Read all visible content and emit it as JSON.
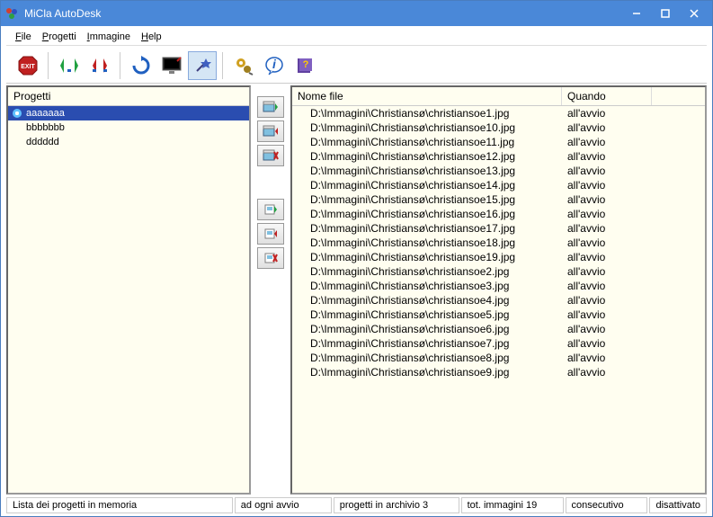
{
  "window": {
    "title": "MiCla AutoDesk"
  },
  "menu": {
    "file": "File",
    "progetti": "Progetti",
    "immagine": "Immagine",
    "help": "Help"
  },
  "panels": {
    "projects_header": "Progetti",
    "file_col": "Nome file",
    "when_col": "Quando"
  },
  "projects": [
    {
      "name": "aaaaaaa",
      "selected": true
    },
    {
      "name": "bbbbbbb",
      "selected": false
    },
    {
      "name": "dddddd",
      "selected": false
    }
  ],
  "files": [
    {
      "path": "D:\\Immagini\\Christiansø\\christiansoe1.jpg",
      "when": "all'avvio"
    },
    {
      "path": "D:\\Immagini\\Christiansø\\christiansoe10.jpg",
      "when": "all'avvio"
    },
    {
      "path": "D:\\Immagini\\Christiansø\\christiansoe11.jpg",
      "when": "all'avvio"
    },
    {
      "path": "D:\\Immagini\\Christiansø\\christiansoe12.jpg",
      "when": "all'avvio"
    },
    {
      "path": "D:\\Immagini\\Christiansø\\christiansoe13.jpg",
      "when": "all'avvio"
    },
    {
      "path": "D:\\Immagini\\Christiansø\\christiansoe14.jpg",
      "when": "all'avvio"
    },
    {
      "path": "D:\\Immagini\\Christiansø\\christiansoe15.jpg",
      "when": "all'avvio"
    },
    {
      "path": "D:\\Immagini\\Christiansø\\christiansoe16.jpg",
      "when": "all'avvio"
    },
    {
      "path": "D:\\Immagini\\Christiansø\\christiansoe17.jpg",
      "when": "all'avvio"
    },
    {
      "path": "D:\\Immagini\\Christiansø\\christiansoe18.jpg",
      "when": "all'avvio"
    },
    {
      "path": "D:\\Immagini\\Christiansø\\christiansoe19.jpg",
      "when": "all'avvio"
    },
    {
      "path": "D:\\Immagini\\Christiansø\\christiansoe2.jpg",
      "when": "all'avvio"
    },
    {
      "path": "D:\\Immagini\\Christiansø\\christiansoe3.jpg",
      "when": "all'avvio"
    },
    {
      "path": "D:\\Immagini\\Christiansø\\christiansoe4.jpg",
      "when": "all'avvio"
    },
    {
      "path": "D:\\Immagini\\Christiansø\\christiansoe5.jpg",
      "when": "all'avvio"
    },
    {
      "path": "D:\\Immagini\\Christiansø\\christiansoe6.jpg",
      "when": "all'avvio"
    },
    {
      "path": "D:\\Immagini\\Christiansø\\christiansoe7.jpg",
      "when": "all'avvio"
    },
    {
      "path": "D:\\Immagini\\Christiansø\\christiansoe8.jpg",
      "when": "all'avvio"
    },
    {
      "path": "D:\\Immagini\\Christiansø\\christiansoe9.jpg",
      "when": "all'avvio"
    }
  ],
  "status": {
    "s1": "Lista dei progetti in memoria",
    "s2": "ad ogni avvio",
    "s3": "progetti in archivio 3",
    "s4": "tot. immagini 19",
    "s5": "consecutivo",
    "s6": "disattivato"
  }
}
